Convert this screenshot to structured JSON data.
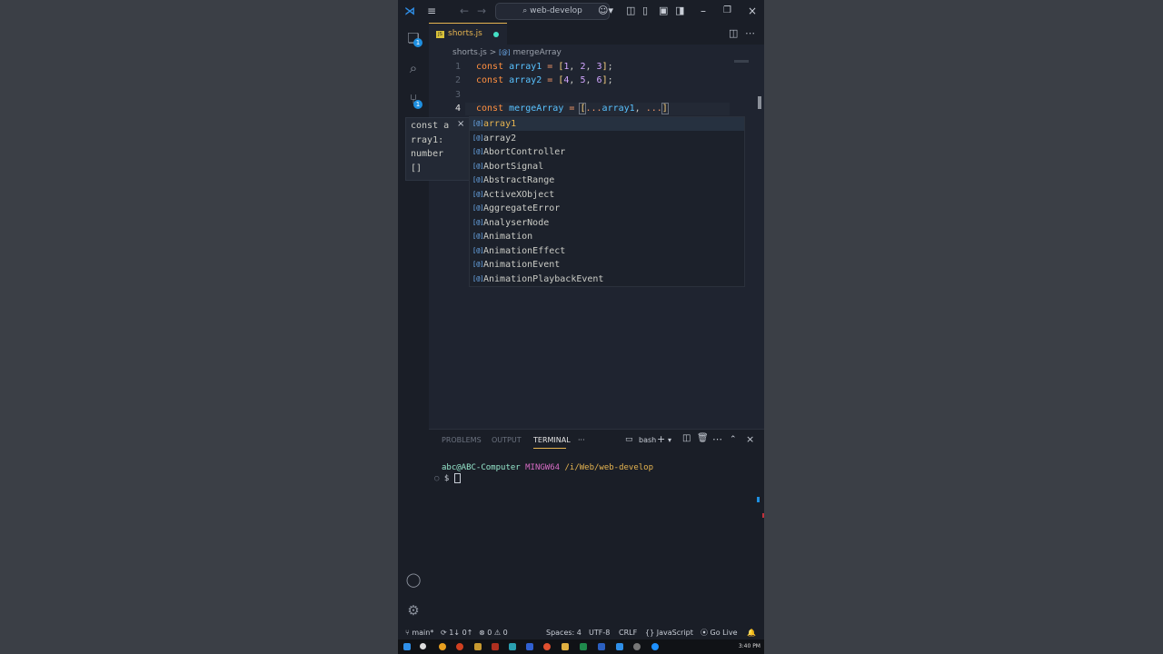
{
  "titlebar": {
    "search_label": "web-develop",
    "icons": [
      "vscode-logo-icon",
      "menu-icon",
      "back-arrow-icon",
      "forward-arrow-icon",
      "search-icon",
      "copilot-icon",
      "layout-icon",
      "minimize-icon",
      "restore-icon",
      "close-icon"
    ]
  },
  "activity": {
    "explorer_badge": "1",
    "scm_badge": "1"
  },
  "editor": {
    "tab_label": "shorts.js",
    "tab_icon": "JS",
    "breadcrumb_file": "shorts.js",
    "breadcrumb_sep": ">",
    "breadcrumb_symbol_icon": "[@]",
    "breadcrumb_symbol": "mergeArray",
    "line_numbers": [
      "1",
      "2",
      "3",
      "4"
    ],
    "line1": {
      "kw": "const",
      "name": "array1",
      "op": "=",
      "open": "[",
      "n1": "1",
      "n2": "2",
      "n3": "3",
      "close": "]",
      "end": ";"
    },
    "line2": {
      "kw": "const",
      "name": "array2",
      "op": "=",
      "open": "[",
      "n1": "4",
      "n2": "5",
      "n3": "6",
      "close": "]",
      "end": ";"
    },
    "line4": {
      "kw": "const",
      "name": "mergeArray",
      "op": "=",
      "open": "[",
      "spread1": "...",
      "arr1": "array1",
      "comma": ",",
      "spread2": "...",
      "close": "]"
    }
  },
  "hover": {
    "lines": [
      "const a",
      "rray1:",
      "number",
      "[]"
    ],
    "close": "×"
  },
  "suggestions": {
    "items": [
      "array1",
      "array2",
      "AbortController",
      "AbortSignal",
      "AbstractRange",
      "ActiveXObject",
      "AggregateError",
      "AnalyserNode",
      "Animation",
      "AnimationEffect",
      "AnimationEvent",
      "AnimationPlaybackEvent"
    ],
    "icon": "[@]"
  },
  "panel": {
    "tabs": [
      "PROBLEMS",
      "OUTPUT",
      "TERMINAL"
    ],
    "more": "···",
    "shell_label": "bash",
    "terminal_user": "abc@ABC-Computer",
    "terminal_host": "MINGW64",
    "terminal_path": "/i/Web/web-develop",
    "prompt": "$"
  },
  "status": {
    "branch": "main*",
    "sync": "1↓ 0↑",
    "errors": "0",
    "warnings": "0",
    "spaces": "Spaces: 4",
    "encoding": "UTF-8",
    "eol": "CRLF",
    "language": "JavaScript",
    "golive": "Go Live"
  },
  "taskbar": {
    "clock": "3:40 PM"
  },
  "colors": {
    "accent": "#e6b450",
    "keyword": "#ff8f40",
    "variable": "#59c2ff",
    "number": "#d2a6ff",
    "terminal_user": "#95e6cb",
    "terminal_host": "#d96cc6",
    "terminal_path": "#e6b450"
  }
}
